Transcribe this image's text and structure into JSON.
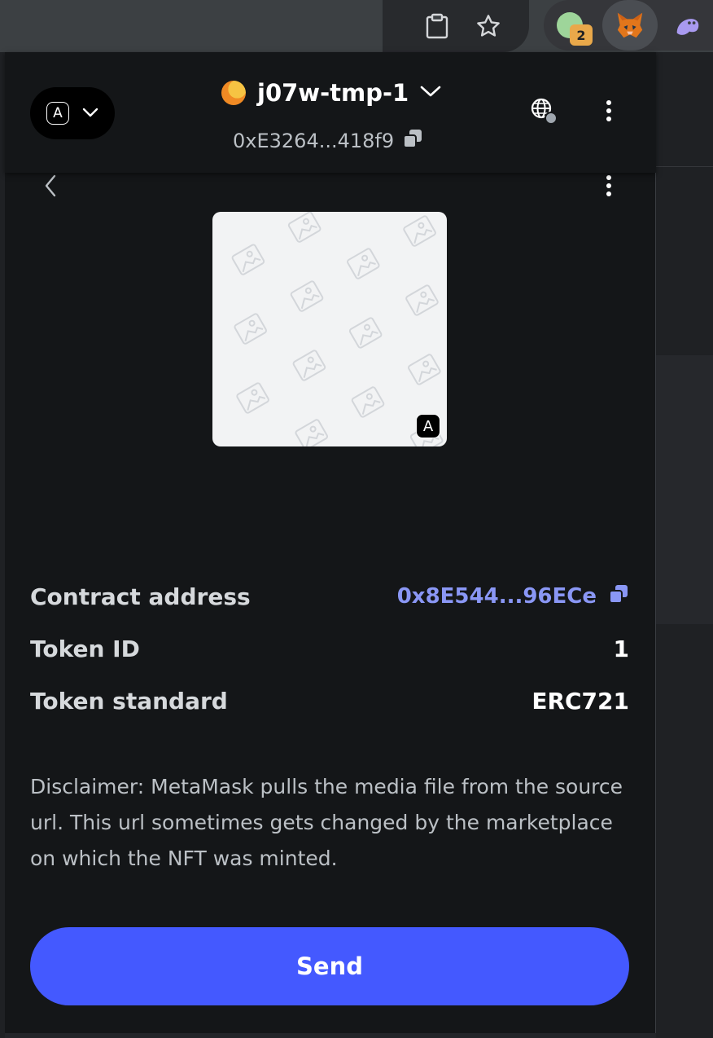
{
  "browser": {
    "extension_badge": "2"
  },
  "header": {
    "network_avatar_letter": "A",
    "account_name": "j07w-tmp-1",
    "account_address": "0xE3264...418f9"
  },
  "nft": {
    "network_badge_letter": "A"
  },
  "details": [
    {
      "label": "Contract address",
      "value": "0x8E544...96ECe"
    },
    {
      "label": "Token ID",
      "value": "1"
    },
    {
      "label": "Token standard",
      "value": "ERC721"
    }
  ],
  "disclaimer": "Disclaimer: MetaMask pulls the media file from the source url. This url sometimes gets changed by the marketplace on which the NFT was minted.",
  "actions": {
    "send_label": "Send"
  },
  "colors": {
    "accent": "#4459ff",
    "link": "#8a97f5",
    "background": "#141618"
  }
}
